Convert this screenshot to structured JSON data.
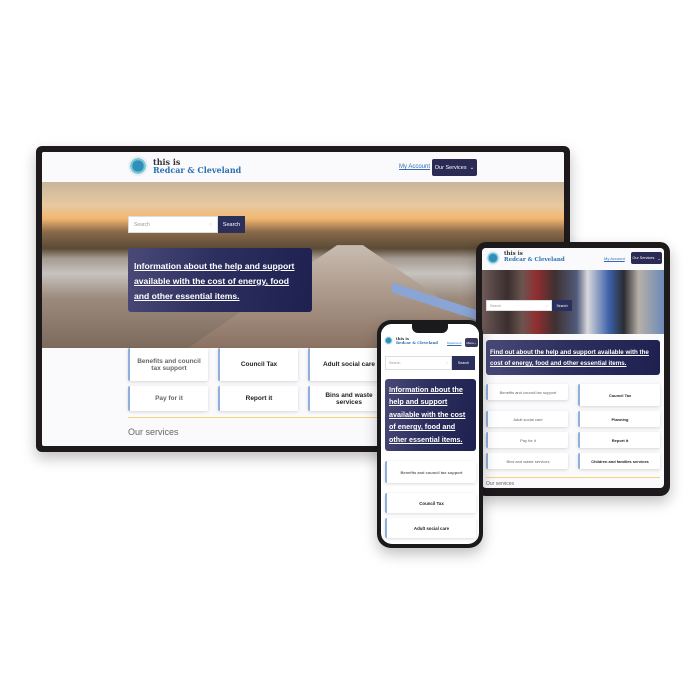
{
  "brand": {
    "line1": "this is",
    "line2": "Redcar & Cleveland"
  },
  "colors": {
    "primary_navy": "#2a2a55",
    "link_blue": "#2e6db4",
    "accent_yellow": "#f1d67a",
    "card_border": "#8fb0dc"
  },
  "desktop": {
    "header": {
      "my_account": "My Account",
      "our_services": "Our Services",
      "chevron_icon": "chevron-down"
    },
    "search": {
      "placeholder": "Search",
      "button": "Search",
      "icon": "search"
    },
    "promo": "Information about the help and support available with the cost of energy, food and other essential items.",
    "cards": [
      {
        "label": "Benefits and council tax support"
      },
      {
        "label": "Council Tax"
      },
      {
        "label": "Adult social care"
      },
      {
        "label": "Pay for it"
      },
      {
        "label": "Report it"
      },
      {
        "label": "Bins and waste services"
      }
    ],
    "section_title": "Our services"
  },
  "tablet": {
    "header": {
      "my_account": "My Account",
      "our_services": "Our Services"
    },
    "search": {
      "placeholder": "Search",
      "button": "Search"
    },
    "promo": "Find out about the help and support available with the cost of energy, food and other essential items.",
    "cards": [
      {
        "label": "Benefits and council tax support"
      },
      {
        "label": "Council Tax"
      },
      {
        "label": "Adult social care"
      },
      {
        "label": "Planning"
      },
      {
        "label": "Pay for it"
      },
      {
        "label": "Report it"
      },
      {
        "label": "Bins and waste services"
      },
      {
        "label": "Children and families services"
      }
    ],
    "section_title": "Our services"
  },
  "phone": {
    "header": {
      "my_account": "Myaccount",
      "menu": "Menu"
    },
    "search": {
      "placeholder": "Search",
      "button": "Search"
    },
    "promo": "Information about the help and support available with the cost of energy, food and other essential items.",
    "cards": [
      {
        "label": "Benefits and council tax support"
      },
      {
        "label": "Council Tax"
      },
      {
        "label": "Adult social care"
      }
    ]
  }
}
